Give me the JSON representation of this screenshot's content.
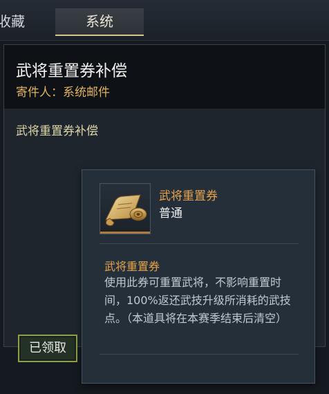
{
  "tabs": [
    {
      "label": "收藏"
    },
    {
      "label": "系统",
      "active": true
    }
  ],
  "mail": {
    "title": "武将重置券补偿",
    "sender_label": "寄件人：",
    "sender": "系统邮件",
    "body": "武将重置券补偿",
    "claim_status": "已领取"
  },
  "tooltip": {
    "item_icon": "scroll-icon",
    "item_name": "武将重置券",
    "rarity": "普通",
    "desc_title": "武将重置券",
    "desc_text": "使用此券可重置武将，不影响重置时间，100%返还武技升级所消耗的武技点。（本道具将在本赛季结束后清空）"
  },
  "colors": {
    "accent_gold": "#d8c887",
    "item_orange": "#e6a34c",
    "claimed_border": "#8ea04a"
  }
}
